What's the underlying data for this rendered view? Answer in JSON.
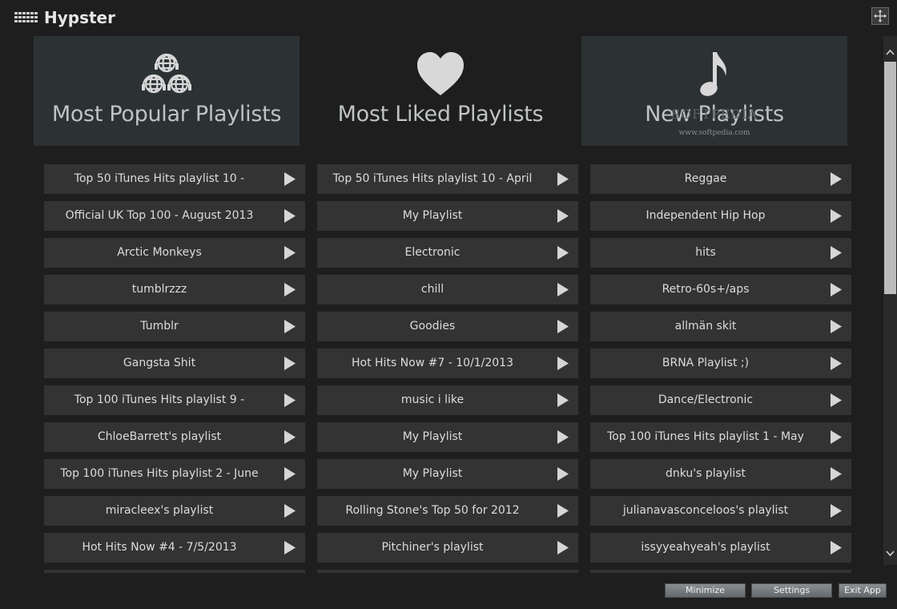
{
  "app": {
    "title": "Hypster",
    "app_icon": "grid-icon",
    "move_icon": "move-arrows-icon"
  },
  "categories": [
    {
      "title": "Most Popular Playlists",
      "icon": "globe-headphones-icon"
    },
    {
      "title": "Most Liked Playlists",
      "icon": "heart-icon"
    },
    {
      "title": "New Playlists",
      "icon": "music-note-icon",
      "watermark_top": "SOFTPEDIA",
      "watermark": "www.softpedia.com"
    }
  ],
  "columns": [
    [
      "Top 50 iTunes Hits playlist 10 -",
      "Official UK Top 100 - August 2013",
      "Arctic Monkeys",
      "tumblrzzz",
      "Tumblr",
      "Gangsta Shit",
      "Top 100 iTunes Hits playlist 9 -",
      "ChloeBarrett's playlist",
      "Top 100 iTunes Hits playlist 2 - June",
      "miracleex's playlist",
      "Hot Hits Now #4 - 7/5/2013",
      ""
    ],
    [
      "Top 50 iTunes Hits playlist 10 - April",
      "My Playlist",
      "Electronic",
      "chill",
      "Goodies",
      "Hot Hits Now #7 - 10/1/2013",
      "music i like",
      "My Playlist",
      "My Playlist",
      "Rolling Stone's Top 50 for 2012",
      "Pitchiner's playlist",
      ""
    ],
    [
      "Reggae",
      "Independent Hip Hop",
      "hits",
      "Retro-60s+/aps",
      "allmän skit",
      "BRNA Playlist ;)",
      "Dance/Electronic",
      "Top 100 iTunes Hits playlist 1 - May",
      "dnku's playlist",
      "julianavasconceloos's playlist",
      "issyyeahyeah's playlist",
      ""
    ]
  ],
  "buttons": {
    "minimize": "Minimize",
    "settings": "Settings",
    "exit": "Exit App"
  },
  "colors": {
    "background": "#1e1e1e",
    "row": "#333333",
    "card": "#2c3134"
  }
}
